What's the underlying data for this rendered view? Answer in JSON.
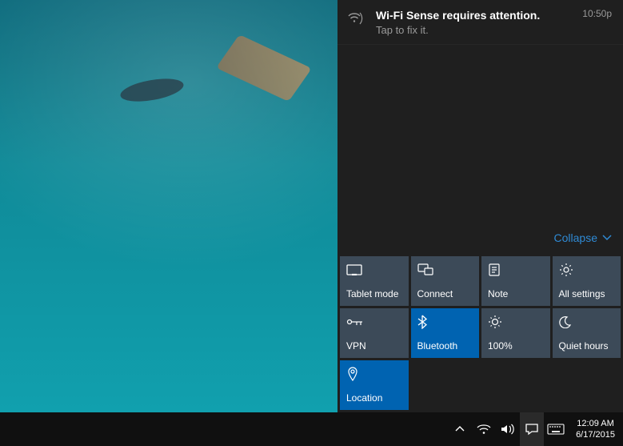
{
  "notification": {
    "title": "Wi-Fi Sense requires attention.",
    "subtitle": "Tap to fix it.",
    "time": "10:50p"
  },
  "collapse": {
    "label": "Collapse"
  },
  "tiles": [
    {
      "id": "tablet-mode",
      "label": "Tablet mode",
      "icon": "tablet",
      "active": false
    },
    {
      "id": "connect",
      "label": "Connect",
      "icon": "connect",
      "active": false
    },
    {
      "id": "note",
      "label": "Note",
      "icon": "note",
      "active": false
    },
    {
      "id": "all-settings",
      "label": "All settings",
      "icon": "gear",
      "active": false
    },
    {
      "id": "vpn",
      "label": "VPN",
      "icon": "vpn",
      "active": false
    },
    {
      "id": "bluetooth",
      "label": "Bluetooth",
      "icon": "bluetooth",
      "active": true
    },
    {
      "id": "brightness",
      "label": "100%",
      "icon": "sun",
      "active": false
    },
    {
      "id": "quiet-hours",
      "label": "Quiet hours",
      "icon": "moon",
      "active": false
    },
    {
      "id": "location",
      "label": "Location",
      "icon": "location",
      "active": true
    }
  ],
  "taskbar": {
    "time": "12:09 AM",
    "date": "6/17/2015"
  }
}
